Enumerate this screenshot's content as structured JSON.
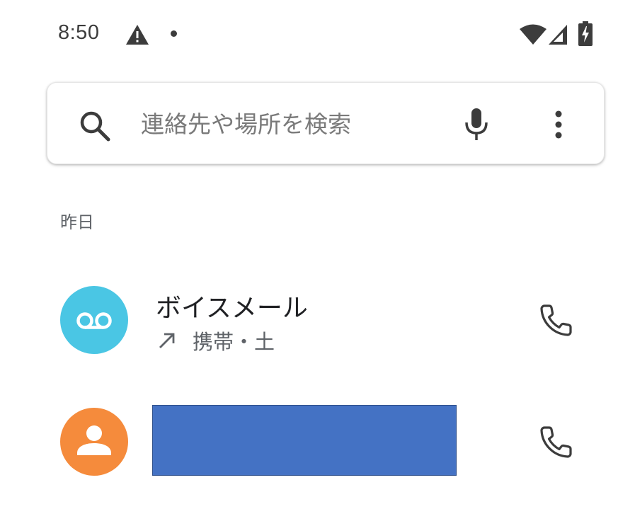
{
  "status_bar": {
    "time": "8:50",
    "icons": [
      "warning-icon",
      "notification-dot-icon",
      "wifi-icon",
      "cell-signal-icon",
      "battery-charging-icon"
    ]
  },
  "search": {
    "placeholder": "連絡先や場所を検索",
    "value": "",
    "icons": [
      "search-icon",
      "mic-icon",
      "more-vert-icon"
    ]
  },
  "call_log": {
    "section_header": "昨日",
    "entries": [
      {
        "name": "ボイスメール",
        "direction_icon": "outgoing-call-arrow-icon",
        "meta": "携帯・土",
        "avatar_icon": "voicemail-icon",
        "avatar_color": "#4ac6e4",
        "action_icon": "phone-icon"
      },
      {
        "name_redacted": true,
        "avatar_icon": "person-icon",
        "avatar_color": "#f58b3c",
        "redaction_color": "#4472c4",
        "action_icon": "phone-icon"
      }
    ]
  },
  "colors": {
    "text_primary": "#202124",
    "text_secondary": "#5f6368",
    "icon_gray": "#5f6368"
  }
}
